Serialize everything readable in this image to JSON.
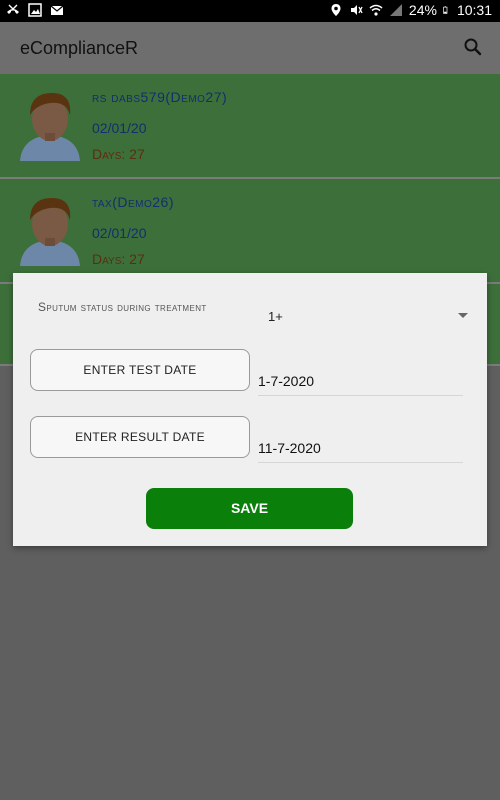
{
  "status_bar": {
    "battery": "24%",
    "time": "10:31"
  },
  "app_bar": {
    "title": "eComplianceR"
  },
  "patients": [
    {
      "name": "rs   dabs579(Demo27)",
      "date": "02/01/20",
      "days": "Days: 27"
    },
    {
      "name": "tax(Demo26)",
      "date": "02/01/20",
      "days": "Days: 27"
    },
    {
      "name": "",
      "date": "",
      "days": ""
    }
  ],
  "dialog": {
    "sputum_label": "Sputum status during treatment",
    "sputum_value": "1+",
    "test_button": "ENTER TEST DATE",
    "test_date": "1-7-2020",
    "result_button": "ENTER RESULT DATE",
    "result_date": "11-7-2020",
    "save_button": "SAVE"
  },
  "colors": {
    "save_green": "#0a7f0a",
    "item_green": "#3d6f3b"
  }
}
